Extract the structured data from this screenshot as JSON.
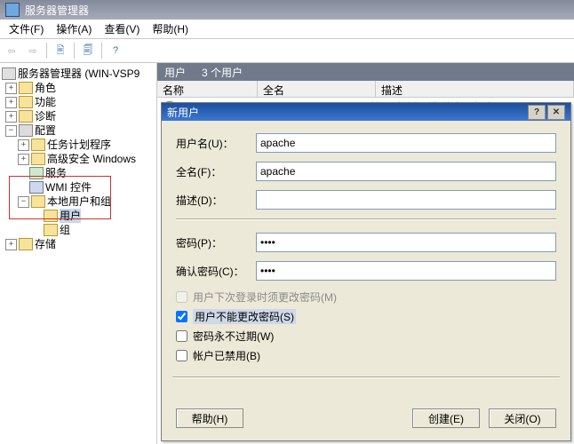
{
  "window": {
    "title": "服务器管理器"
  },
  "menu": {
    "file": "文件(F)",
    "action": "操作(A)",
    "view": "查看(V)",
    "help": "帮助(H)"
  },
  "tree": {
    "root": "服务器管理器 (WIN-VSP9",
    "roles": "角色",
    "features": "功能",
    "diag": "诊断",
    "config": "配置",
    "task": "任务计划程序",
    "firewall": "高级安全 Windows",
    "services": "服务",
    "wmi": "WMI 控件",
    "lug": "本地用户和组",
    "users": "用户",
    "groups": "组",
    "storage": "存储"
  },
  "content": {
    "header_label": "用户",
    "header_count": "3 个用户",
    "col_name": "名称",
    "col_full": "全名",
    "col_desc": "描述",
    "row_name": "Admini...",
    "row_desc": "管理计算机(域)的内置帐户"
  },
  "dialog": {
    "title": "新用户",
    "username_label": "用户名(U)：",
    "username": "apache",
    "fullname_label": "全名(F)：",
    "fullname": "apache",
    "desc_label": "描述(D)：",
    "desc": "",
    "password_label": "密码(P)：",
    "password": "••••",
    "confirm_label": "确认密码(C)：",
    "confirm": "••••",
    "chk_mustchange": "用户下次登录时须更改密码(M)",
    "chk_cannot": "用户不能更改密码(S)",
    "chk_never": "密码永不过期(W)",
    "chk_disabled": "帐户已禁用(B)",
    "btn_help": "帮助(H)",
    "btn_create": "创建(E)",
    "btn_close": "关闭(O)"
  }
}
